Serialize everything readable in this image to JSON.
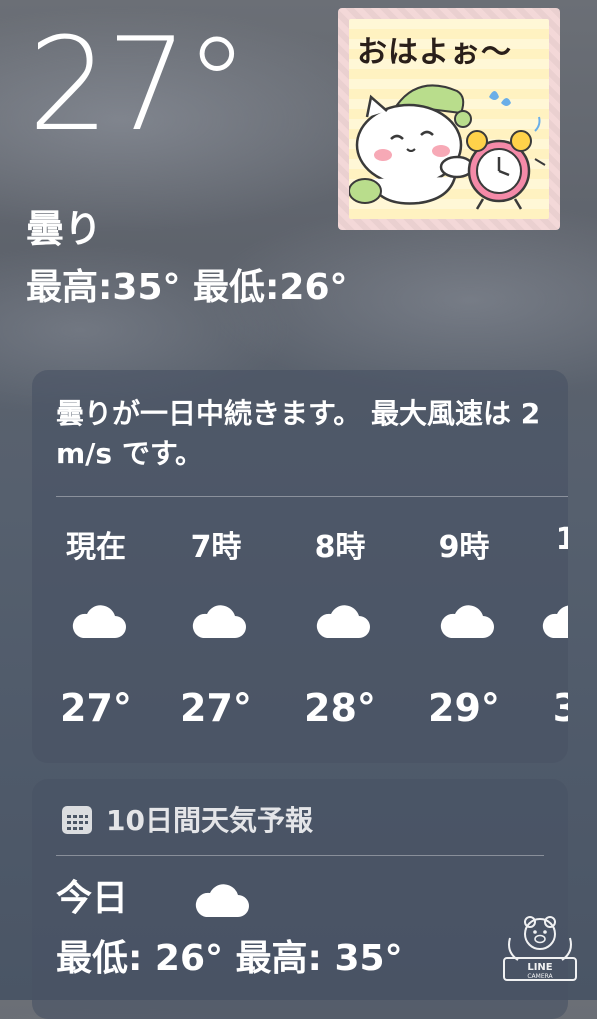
{
  "current": {
    "temperature": "27°",
    "condition": "曇り",
    "hi_lo": "最高:35°  最低:26°"
  },
  "sticker": {
    "text": "おはよぉ〜"
  },
  "hourly": {
    "summary": "曇りが一日中続きます。 最大風速は 2 m/s です。",
    "hours": [
      {
        "label": "現在",
        "icon": "cloud-icon",
        "temp": "27°"
      },
      {
        "label": "7時",
        "icon": "cloud-icon",
        "temp": "27°"
      },
      {
        "label": "8時",
        "icon": "cloud-icon",
        "temp": "28°"
      },
      {
        "label": "9時",
        "icon": "cloud-icon",
        "temp": "29°"
      },
      {
        "label": "1",
        "icon": "cloud-icon",
        "temp": "3"
      }
    ]
  },
  "daily": {
    "title": "10日間天気予報",
    "icon": "calendar-icon",
    "today": {
      "day": "今日",
      "icon": "cloud-icon",
      "range": "最低: 26°  最高: 35°"
    }
  },
  "watermark": {
    "line1": "LINE",
    "line2": "CAMERA"
  }
}
